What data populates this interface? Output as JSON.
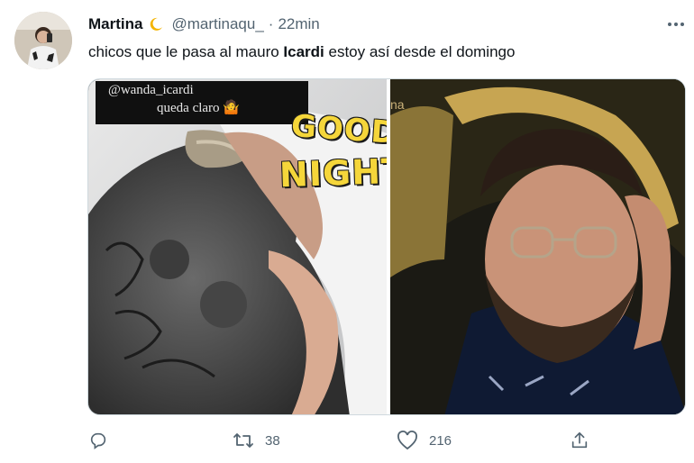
{
  "tweet": {
    "author_name": "Martina",
    "author_emoji": "crescent-moon",
    "handle": "@martinaqu_",
    "separator": "·",
    "time": "22min",
    "text_before": "chicos que le pasa al mauro ",
    "text_bold": "Icardi",
    "text_after": " estoy así desde el domingo"
  },
  "media": {
    "left": {
      "story_tag": "@wanda_icardi",
      "story_sub": "queda claro 🤷",
      "sticker_line1": "GOOD",
      "sticker_line2": "NIGHT"
    },
    "right": {
      "watermark": "na"
    }
  },
  "actions": {
    "reply_icon": "reply-icon",
    "retweet_icon": "retweet-icon",
    "retweet_count": "38",
    "like_icon": "heart-icon",
    "like_count": "216",
    "share_icon": "share-icon"
  },
  "colors": {
    "text": "#0f1419",
    "secondary": "#536471",
    "sticker_yellow": "#f5d63a"
  }
}
